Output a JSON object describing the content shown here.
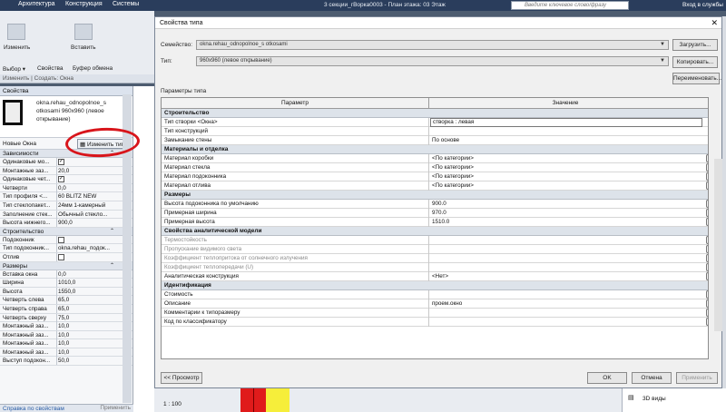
{
  "app": {
    "tabs": [
      "Архитектура",
      "Конструкция",
      "Системы"
    ],
    "title": "3 секции_гВорка0003 - План этажа: 03 Этаж",
    "search_placeholder": "Введите ключевое слово/фразу",
    "login": "Вход в службы"
  },
  "ribbon": {
    "modify": "Изменить",
    "paste": "Вставить",
    "select": "Выбор ▾",
    "properties": "Свойства",
    "clipboard": "Буфер обмена",
    "modify_bar": "Изменить | Создать: Окна"
  },
  "properties": {
    "header": "Свойства",
    "type_name": "okna.rehau_odnopolnoe_s otkosami 960x960 (левое открывание)",
    "selector": "Новые Окна",
    "edit_type": "Изменить тип",
    "groups": [
      {
        "name": "Зависимости",
        "rows": [
          {
            "label": "Одинаковые мо...",
            "value": "",
            "check": true
          },
          {
            "label": "Монтажные заз...",
            "value": "20,0",
            "check": false
          },
          {
            "label": "Одинаковые чет...",
            "value": "",
            "check": true
          },
          {
            "label": "Четверти",
            "value": "0,0",
            "check": false
          },
          {
            "label": "Тип профиля <...",
            "value": "60 BLITZ NEW",
            "check": false
          },
          {
            "label": "Тип стеклопакет...",
            "value": "24мм 1-камерный",
            "check": false
          },
          {
            "label": "Заполнение стек...",
            "value": "Обычный стекло...",
            "check": false
          },
          {
            "label": "Высота нижнего...",
            "value": "900,0",
            "check": false
          }
        ]
      },
      {
        "name": "Строительство",
        "rows": [
          {
            "label": "Подоконник",
            "value": "",
            "check": false,
            "box": true
          },
          {
            "label": "Тип подоконник...",
            "value": "okna.rehau_подок...",
            "check": false
          },
          {
            "label": "Отлив",
            "value": "",
            "check": false,
            "box": true
          }
        ]
      },
      {
        "name": "Размеры",
        "rows": [
          {
            "label": "Вставка окна",
            "value": "0,0",
            "check": false
          },
          {
            "label": "Ширина",
            "value": "1010,0",
            "check": false
          },
          {
            "label": "Высота",
            "value": "1550,0",
            "check": false
          },
          {
            "label": "Четверть слева",
            "value": "65,0",
            "check": false
          },
          {
            "label": "Четверть справа",
            "value": "65,0",
            "check": false
          },
          {
            "label": "Четверть сверху",
            "value": "75,0",
            "check": false
          },
          {
            "label": "Монтажный заз...",
            "value": "10,0",
            "check": false
          },
          {
            "label": "Монтажный заз...",
            "value": "10,0",
            "check": false
          },
          {
            "label": "Монтажный заз...",
            "value": "10,0",
            "check": false
          },
          {
            "label": "Монтажный заз...",
            "value": "10,0",
            "check": false
          },
          {
            "label": "Выступ подокон...",
            "value": "50,0",
            "check": false
          }
        ]
      }
    ],
    "help_link": "Справка по свойствам",
    "apply": "Применить"
  },
  "dialog": {
    "title": "Свойства типа",
    "close": "✕",
    "family_label": "Семейство:",
    "family_value": "okna.rehau_odnopolnoe_s otkosami",
    "type_label": "Тип:",
    "type_value": "960x960 (левое открывание)",
    "load_btn": "Загрузить...",
    "copy_btn": "Копировать...",
    "rename_btn": "Переименовать...",
    "params_label": "Параметры типа",
    "col_param": "Параметр",
    "col_value": "Значение",
    "groups": [
      {
        "name": "Строительство",
        "rows": [
          {
            "label": "Тип створки <Окна>",
            "value": "створка : левая",
            "active": true
          },
          {
            "label": "Тип конструкций",
            "value": ""
          },
          {
            "label": "Замыкание стены",
            "value": "По основе"
          }
        ]
      },
      {
        "name": "Материалы и отделка",
        "rows": [
          {
            "label": "Материал коробки",
            "value": "<По категории>",
            "pick": true
          },
          {
            "label": "Материал стекла",
            "value": "<По категории>",
            "pick": true
          },
          {
            "label": "Материал подоконника",
            "value": "<По категории>",
            "pick": true
          },
          {
            "label": "Материал отлива",
            "value": "<По категории>",
            "pick": true
          }
        ]
      },
      {
        "name": "Размеры",
        "rows": [
          {
            "label": "Высота подоконника по умолчанию",
            "value": "900.0",
            "pick": true
          },
          {
            "label": "Примерная ширина",
            "value": "970.0",
            "pick": true
          },
          {
            "label": "Примерная высота",
            "value": "1510.0",
            "pick": true
          }
        ]
      },
      {
        "name": "Свойства аналитической модели",
        "rows": [
          {
            "label": "Термостойкость",
            "value": "",
            "dim": true,
            "pick": true
          },
          {
            "label": "Пропускание видимого света",
            "value": "",
            "dim": true,
            "pick": true
          },
          {
            "label": "Коэффициент теплопритока от солнечного излучения",
            "value": "",
            "dim": true,
            "pick": true
          },
          {
            "label": "Коэффициент теплопередачи (U)",
            "value": "",
            "dim": true,
            "pick": true
          },
          {
            "label": "Аналитическая конструкция",
            "value": "<Нет>",
            "pick": true
          }
        ]
      },
      {
        "name": "Идентификация",
        "rows": [
          {
            "label": "Стоимость",
            "value": "",
            "pick": true
          },
          {
            "label": "Описание",
            "value": "проем.окно",
            "pick": true
          },
          {
            "label": "Комментарии к типоразмеру",
            "value": "",
            "pick": true
          },
          {
            "label": "Код по классификатору",
            "value": "",
            "pick": true
          }
        ]
      }
    ],
    "preview_btn": "<< Просмотр",
    "ok_btn": "OK",
    "cancel_btn": "Отмена",
    "apply_btn": "Применить"
  },
  "project_browser": {
    "item": "3D виды"
  },
  "status": {
    "scale": "1 : 100"
  }
}
